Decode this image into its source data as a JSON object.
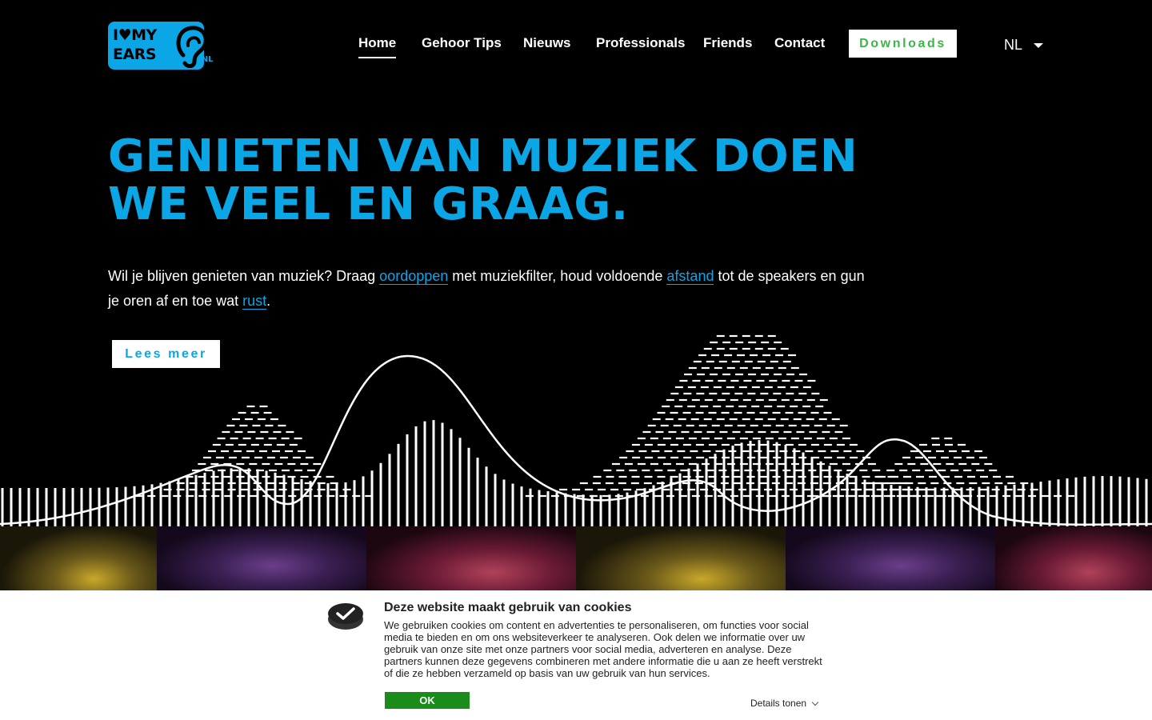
{
  "header": {
    "logo": {
      "line1": "I",
      "heart": "♥",
      "line1_rest": "MY",
      "line2": "EARS",
      "suffix": ".NL"
    },
    "nav": [
      {
        "label": "Home",
        "active": true
      },
      {
        "label": "Gehoor Tips"
      },
      {
        "label": "Nieuws"
      },
      {
        "label": "Professionals"
      },
      {
        "label": "Friends"
      },
      {
        "label": "Contact"
      }
    ],
    "downloads_label": "Downloads",
    "language": "NL"
  },
  "hero": {
    "title_line1": "GENIETEN VAN MUZIEK DOEN",
    "title_line2": "WE VEEL EN GRAAG.",
    "text_part1": "Wil je blijven genieten van muziek? Draag ",
    "link1": "oordoppen",
    "text_part2": " met muziekfilter, houd voldoende ",
    "link2": "afstand",
    "text_part3": " tot de speakers en gun je oren af en toe wat ",
    "link3": "rust",
    "text_part4": ".",
    "button_label": "Lees meer"
  },
  "cookie": {
    "title": "Deze website maakt gebruik van cookies",
    "body": "We gebruiken cookies om content en advertenties te personaliseren, om functies voor social media te bieden en om ons websiteverkeer te analyseren. Ook delen we informatie over uw gebruik van onze site met onze partners voor social media, adverteren en analyse. Deze partners kunnen deze gegevens combineren met andere informatie die u aan ze heeft verstrekt of die ze hebben verzameld op basis van uw gebruik van hun services.",
    "ok_label": "OK",
    "details_label": "Details tonen"
  },
  "colors": {
    "brand_blue": "#0aa6e6",
    "downloads_green": "#3cb64a",
    "ok_green": "#1a8c1a"
  }
}
